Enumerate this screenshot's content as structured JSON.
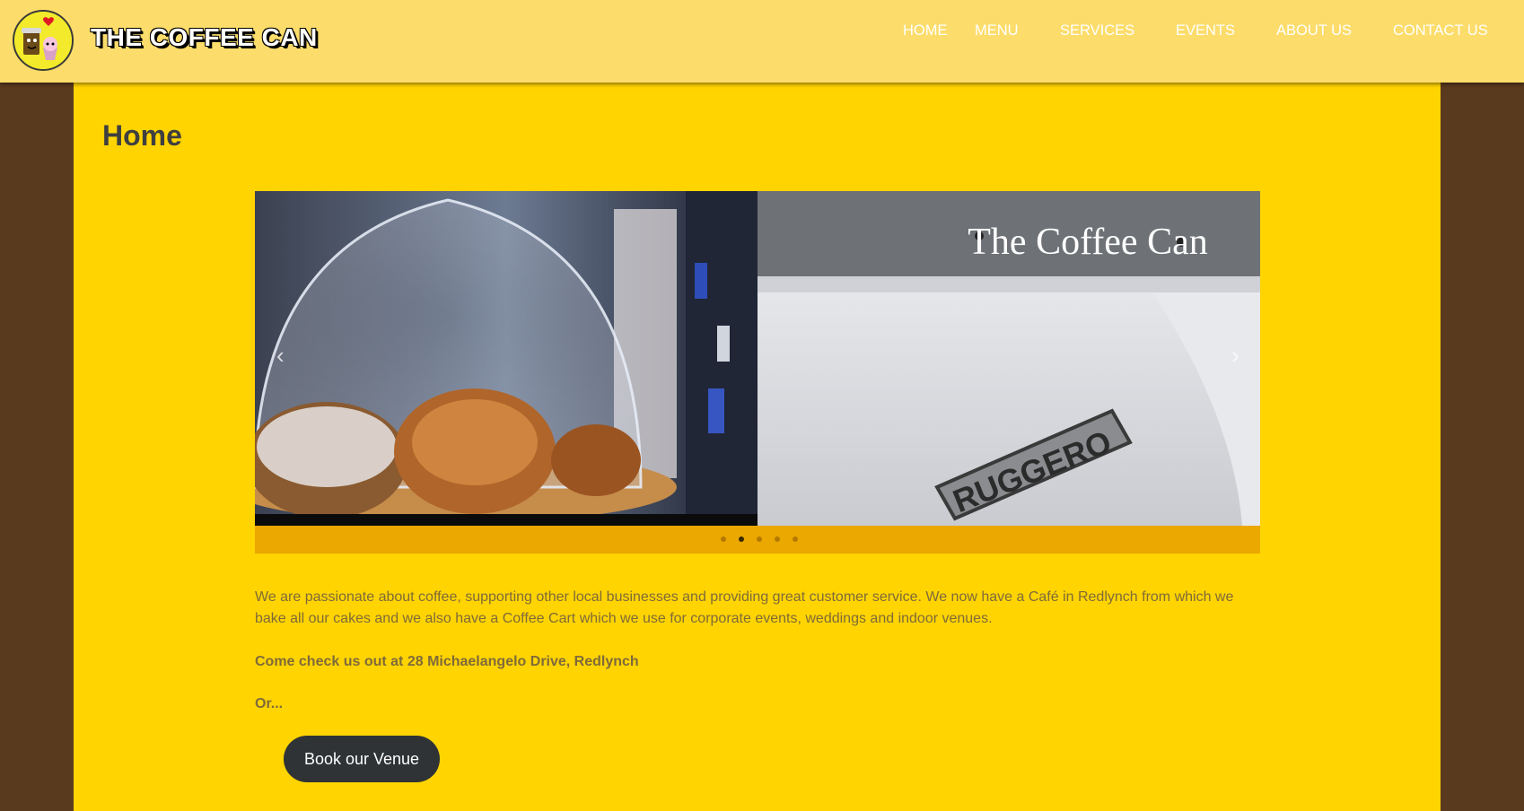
{
  "header": {
    "brand": "THE COFFEE CAN",
    "nav": [
      "HOME",
      "MENU",
      "SERVICES",
      "EVENTS",
      "ABOUT US",
      "CONTACT US"
    ]
  },
  "main": {
    "title": "Home",
    "slider": {
      "right_slide_sign": "The Coffee Can",
      "right_slide_badge": "RUGGERO",
      "dots_count": 5,
      "active_dot": 2
    },
    "intro": "We are passionate about coffee, supporting other local businesses and providing great customer service. We now have a Café in Redlynch from which we bake all our cakes and we also have a Coffee Cart which we use for corporate events, weddings and indoor venues.",
    "address_line": "Come check us out at 28 Michaelangelo Drive, Redlynch",
    "or_line": "Or...",
    "book_button": "Book our Venue"
  },
  "colors": {
    "header_bg": "#fcdc6a",
    "panel_bg": "#ffd400",
    "page_bg": "#5a3a1e",
    "dots_bar": "#eba800",
    "button_bg": "#2f3335"
  }
}
